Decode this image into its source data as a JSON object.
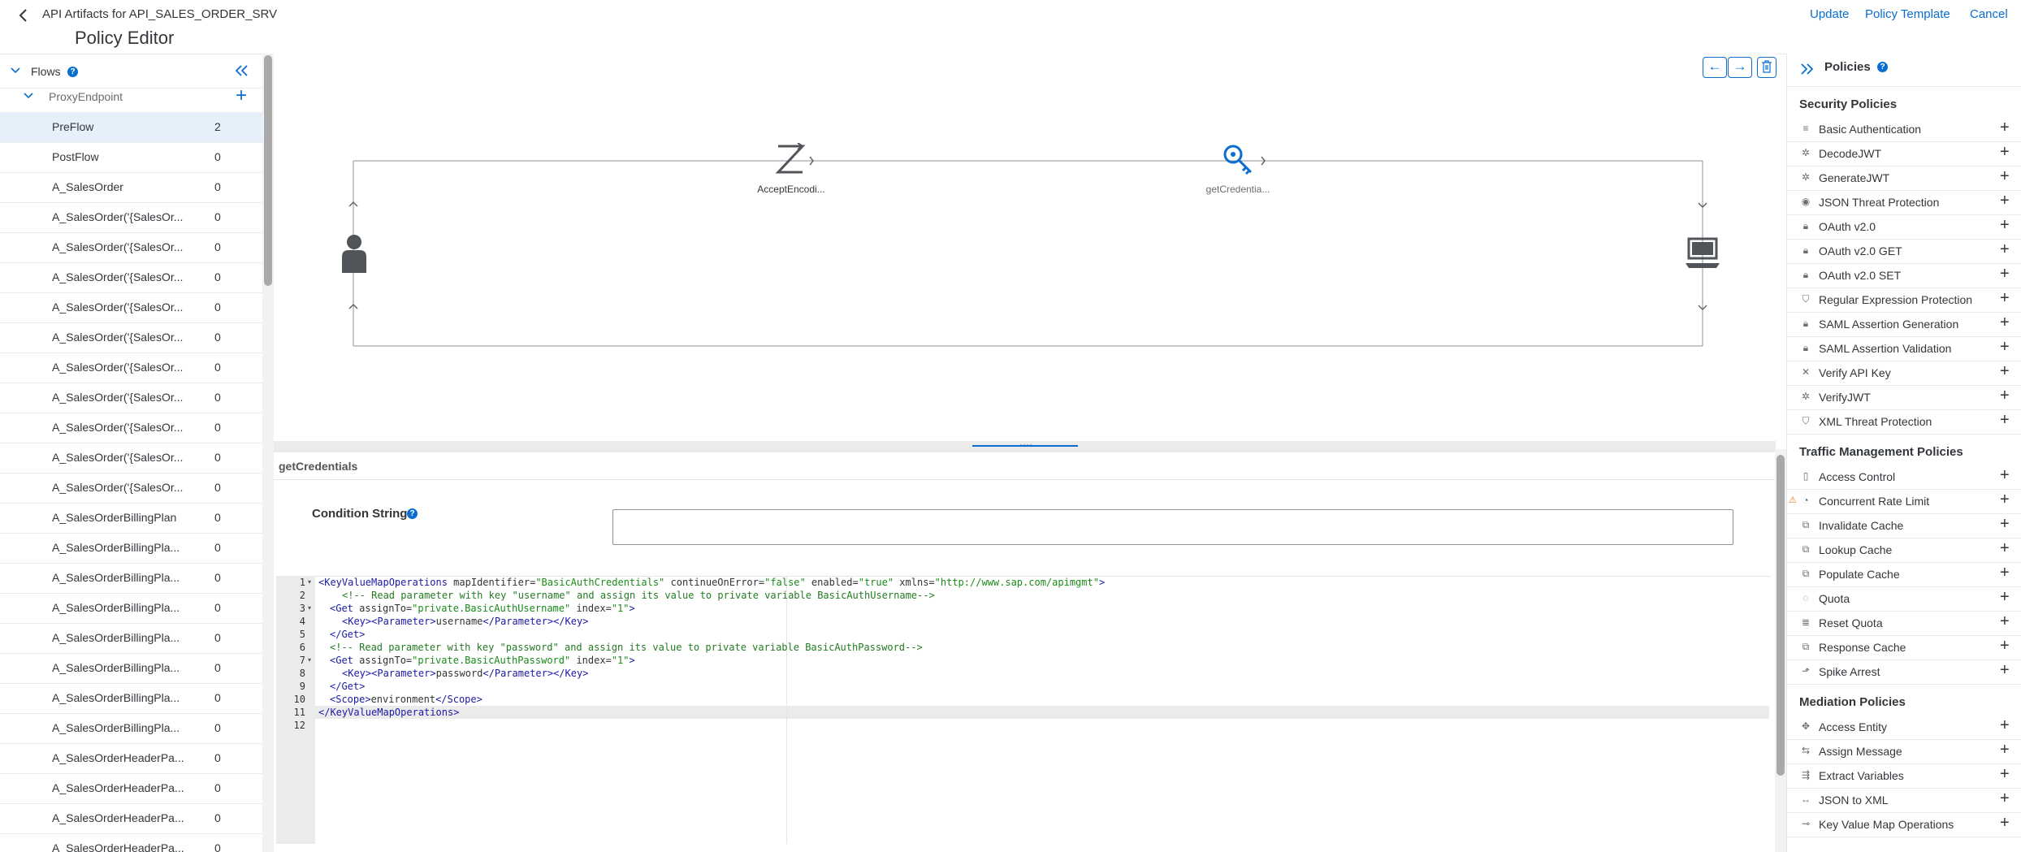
{
  "header": {
    "app_title": "API Artifacts for API_SALES_ORDER_SRV",
    "page_title": "Policy Editor",
    "update": "Update",
    "policy_template": "Policy Template",
    "cancel": "Cancel"
  },
  "flows": {
    "title": "Flows",
    "proxy_endpoint": "ProxyEndpoint",
    "items": [
      {
        "name": "PreFlow",
        "count": "2",
        "selected": true
      },
      {
        "name": "PostFlow",
        "count": "0"
      },
      {
        "name": "A_SalesOrder",
        "count": "0"
      },
      {
        "name": "A_SalesOrder('{SalesOr...",
        "count": "0"
      },
      {
        "name": "A_SalesOrder('{SalesOr...",
        "count": "0"
      },
      {
        "name": "A_SalesOrder('{SalesOr...",
        "count": "0"
      },
      {
        "name": "A_SalesOrder('{SalesOr...",
        "count": "0"
      },
      {
        "name": "A_SalesOrder('{SalesOr...",
        "count": "0"
      },
      {
        "name": "A_SalesOrder('{SalesOr...",
        "count": "0"
      },
      {
        "name": "A_SalesOrder('{SalesOr...",
        "count": "0"
      },
      {
        "name": "A_SalesOrder('{SalesOr...",
        "count": "0"
      },
      {
        "name": "A_SalesOrder('{SalesOr...",
        "count": "0"
      },
      {
        "name": "A_SalesOrder('{SalesOr...",
        "count": "0"
      },
      {
        "name": "A_SalesOrderBillingPlan",
        "count": "0"
      },
      {
        "name": "A_SalesOrderBillingPla...",
        "count": "0"
      },
      {
        "name": "A_SalesOrderBillingPla...",
        "count": "0"
      },
      {
        "name": "A_SalesOrderBillingPla...",
        "count": "0"
      },
      {
        "name": "A_SalesOrderBillingPla...",
        "count": "0"
      },
      {
        "name": "A_SalesOrderBillingPla...",
        "count": "0"
      },
      {
        "name": "A_SalesOrderBillingPla...",
        "count": "0"
      },
      {
        "name": "A_SalesOrderBillingPla...",
        "count": "0"
      },
      {
        "name": "A_SalesOrderHeaderPa...",
        "count": "0"
      },
      {
        "name": "A_SalesOrderHeaderPa...",
        "count": "0"
      },
      {
        "name": "A_SalesOrderHeaderPa...",
        "count": "0"
      },
      {
        "name": "A_SalesOrderHeaderPa...",
        "count": "0"
      }
    ]
  },
  "canvas": {
    "policy1": "AcceptEncodi...",
    "policy2": "getCredentia..."
  },
  "editor": {
    "policy_name": "getCredentials",
    "condition_label": "Condition String",
    "condition_value": "",
    "code": {
      "l1_tag": "<KeyValueMapOperations",
      "l1_a1": " mapIdentifier=",
      "l1_v1": "\"BasicAuthCredentials\"",
      "l1_a2": " continueOnError=",
      "l1_v2": "\"false\"",
      "l1_a3": " enabled=",
      "l1_v3": "\"true\"",
      "l1_a4": " xmlns=",
      "l1_v4": "\"http://www.sap.com/apimgmt\"",
      "l1_end": ">",
      "l2": "<!-- Read parameter with key \"username\" and assign its value to private variable BasicAuthUsername-->",
      "l3_tag": "<Get",
      "l3_a1": " assignTo=",
      "l3_v1": "\"private.BasicAuthUsername\"",
      "l3_a2": " index=",
      "l3_v2": "\"1\"",
      "l3_end": ">",
      "l4_open": "<Key><Parameter>",
      "l4_text": "username",
      "l4_close": "</Parameter></Key>",
      "l5": "</Get>",
      "l6": "<!-- Read parameter with key \"password\" and assign its value to private variable BasicAuthPassword-->",
      "l7_tag": "<Get",
      "l7_a1": " assignTo=",
      "l7_v1": "\"private.BasicAuthPassword\"",
      "l7_a2": " index=",
      "l7_v2": "\"1\"",
      "l7_end": ">",
      "l8_open": "<Key><Parameter>",
      "l8_text": "password",
      "l8_close": "</Parameter></Key>",
      "l9": "</Get>",
      "l10_open": "<Scope>",
      "l10_text": "environment",
      "l10_close": "</Scope>",
      "l11": "</KeyValueMapOperations>",
      "line_numbers": [
        "1",
        "2",
        "3",
        "4",
        "5",
        "6",
        "7",
        "8",
        "9",
        "10",
        "11",
        "12"
      ]
    }
  },
  "policies": {
    "title": "Policies",
    "security_title": "Security Policies",
    "security": [
      "Basic Authentication",
      "DecodeJWT",
      "GenerateJWT",
      "JSON Threat Protection",
      "OAuth v2.0",
      "OAuth v2.0 GET",
      "OAuth v2.0 SET",
      "Regular Expression Protection",
      "SAML Assertion Generation",
      "SAML Assertion Validation",
      "Verify API Key",
      "VerifyJWT",
      "XML Threat Protection"
    ],
    "traffic_title": "Traffic Management Policies",
    "traffic": [
      "Access Control",
      "Concurrent Rate Limit",
      "Invalidate Cache",
      "Lookup Cache",
      "Populate Cache",
      "Quota",
      "Reset Quota",
      "Response Cache",
      "Spike Arrest"
    ],
    "mediation_title": "Mediation Policies",
    "mediation": [
      "Access Entity",
      "Assign Message",
      "Extract Variables",
      "JSON to XML",
      "Key Value Map Operations"
    ]
  },
  "colors": {
    "accent": "#0a6ed1",
    "selected_row": "#e5f0fa",
    "warning": "#e9730c"
  }
}
